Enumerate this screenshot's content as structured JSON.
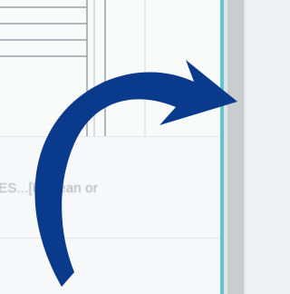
{
  "table": {
    "row_text": "ES...[Protean or"
  },
  "overlay": {
    "arrow_icon": "curved-arrow-right",
    "arrow_color": "#0a3a8c"
  },
  "colors": {
    "accent_border": "#5fc8cf",
    "scrollbar": "#c9cdcf"
  }
}
